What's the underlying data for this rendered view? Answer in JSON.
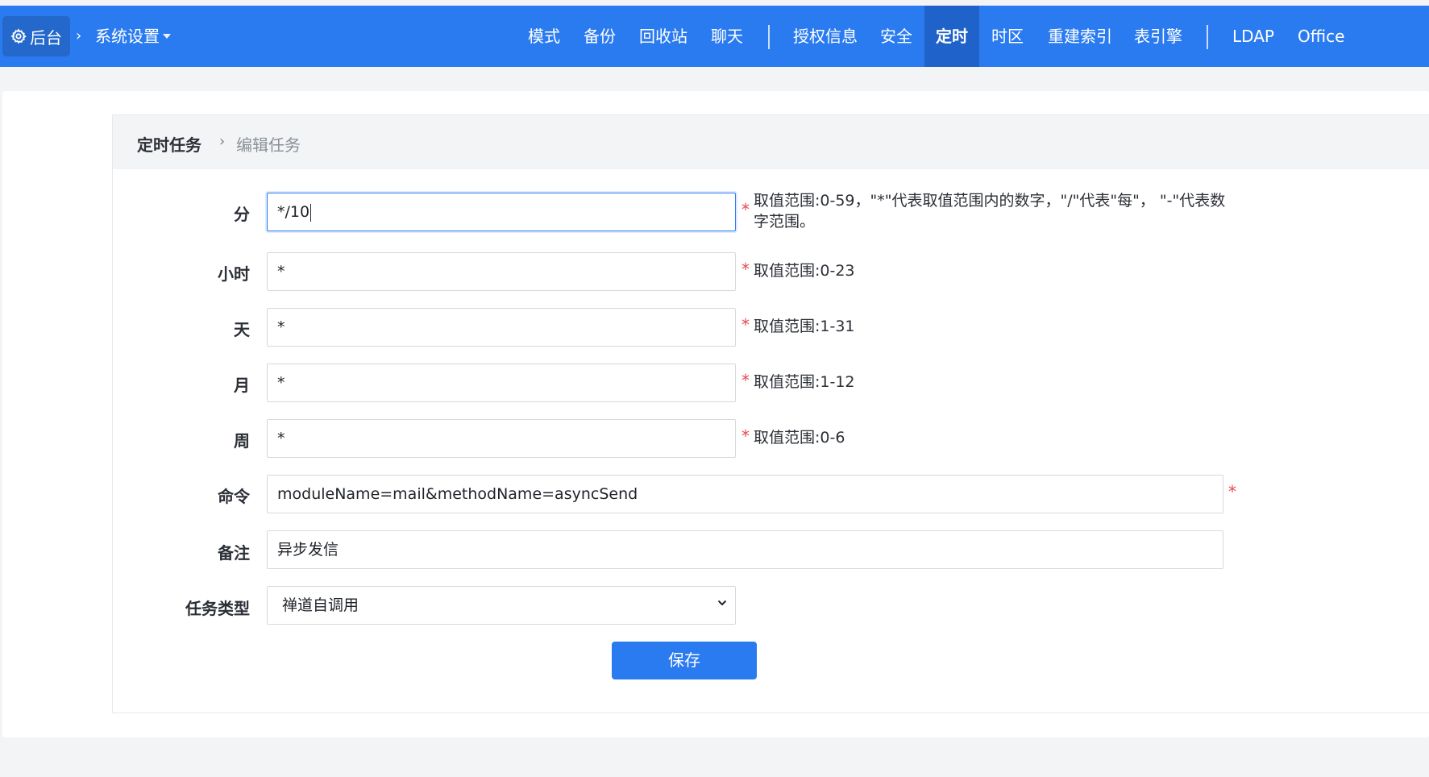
{
  "header": {
    "home_label": "后台",
    "breadcrumb_arrow": "›",
    "system_settings": "系统设置",
    "nav": [
      "模式",
      "备份",
      "回收站",
      "聊天",
      "授权信息",
      "安全",
      "定时",
      "时区",
      "重建索引",
      "表引擎",
      "LDAP",
      "Office"
    ],
    "active_nav": "定时",
    "colors": {
      "bar": "#2b7bf0",
      "active": "#1f62c9"
    }
  },
  "panel": {
    "title": "定时任务",
    "arrow": "›",
    "subtitle": "编辑任务"
  },
  "form": {
    "minute": {
      "label": "分",
      "value": "*/10",
      "required": "*",
      "hint": "取值范围:0-59，\"*\"代表取值范围内的数字，\"/\"代表\"每\"， \"-\"代表数字范围。"
    },
    "hour": {
      "label": "小时",
      "value": "*",
      "required": "*",
      "hint": "取值范围:0-23"
    },
    "day": {
      "label": "天",
      "value": "*",
      "required": "*",
      "hint": "取值范围:1-31"
    },
    "month": {
      "label": "月",
      "value": "*",
      "required": "*",
      "hint": "取值范围:1-12"
    },
    "week": {
      "label": "周",
      "value": "*",
      "required": "*",
      "hint": "取值范围:0-6"
    },
    "command": {
      "label": "命令",
      "value": "moduleName=mail&methodName=asyncSend",
      "required": "*"
    },
    "remark": {
      "label": "备注",
      "value": "异步发信"
    },
    "task_type": {
      "label": "任务类型",
      "value": "禅道自调用"
    },
    "save_label": "保存"
  }
}
